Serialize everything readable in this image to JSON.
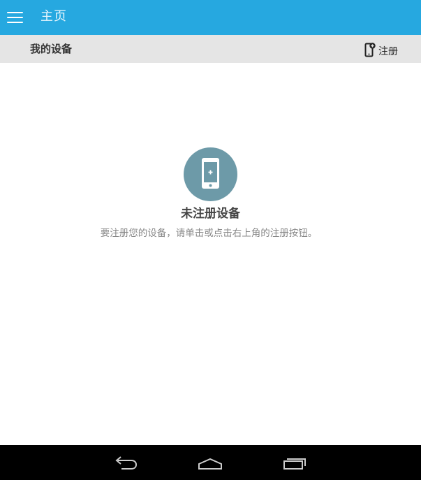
{
  "app": {
    "title": "主页",
    "accent_color": "#26a8e0",
    "menu_icon": "hamburger-menu-icon"
  },
  "subheader": {
    "title": "我的设备",
    "register_icon": "add-device-icon",
    "register_label": "注册"
  },
  "empty_state": {
    "icon": "phone-add-icon",
    "icon_bg_color": "#6d9aa8",
    "title": "未注册设备",
    "description": "要注册您的设备，请单击或点击右上角的注册按钮。"
  },
  "system_nav": {
    "back_icon": "back-icon",
    "home_icon": "home-icon",
    "recent_icon": "recent-apps-icon"
  }
}
